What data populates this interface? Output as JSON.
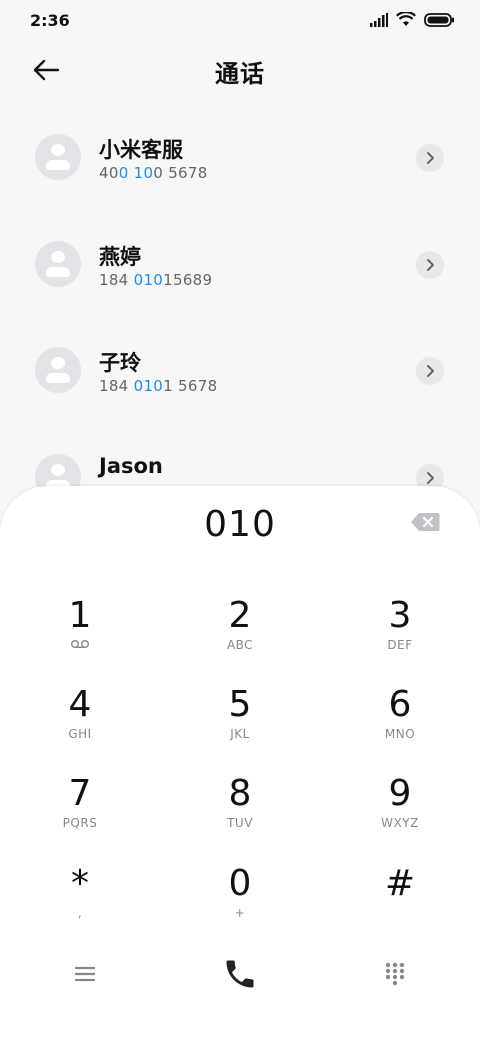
{
  "status_bar": {
    "time": "2:36"
  },
  "header": {
    "title": "通话"
  },
  "contacts": [
    {
      "name": "小米客服",
      "num_pre": "40",
      "num_hl": "0 10",
      "num_post": "0 5678"
    },
    {
      "name": "燕婷",
      "num_pre": "184 ",
      "num_hl": "010",
      "num_post": "15689"
    },
    {
      "name": "子玲",
      "num_pre": "184 ",
      "num_hl": "010",
      "num_post": "1 5678"
    },
    {
      "name": "Jason",
      "num_pre": "",
      "num_hl": "",
      "num_post": ""
    }
  ],
  "dialer": {
    "input": "010",
    "keys": [
      {
        "digit": "1",
        "letters": "voicemail-icon"
      },
      {
        "digit": "2",
        "letters": "ABC"
      },
      {
        "digit": "3",
        "letters": "DEF"
      },
      {
        "digit": "4",
        "letters": "GHI"
      },
      {
        "digit": "5",
        "letters": "JKL"
      },
      {
        "digit": "6",
        "letters": "MNO"
      },
      {
        "digit": "7",
        "letters": "PQRS"
      },
      {
        "digit": "8",
        "letters": "TUV"
      },
      {
        "digit": "9",
        "letters": "WXYZ"
      },
      {
        "digit": "*",
        "letters": ","
      },
      {
        "digit": "0",
        "letters": "+"
      },
      {
        "digit": "#",
        "letters": ""
      }
    ]
  },
  "colors": {
    "accent": "#1c8ce8",
    "background": "#f7f7f7",
    "panel": "#ffffff"
  },
  "icons": [
    "back-arrow-icon",
    "chevron-right-icon",
    "backspace-icon",
    "voicemail-icon",
    "menu-icon",
    "phone-icon",
    "dialpad-icon"
  ]
}
